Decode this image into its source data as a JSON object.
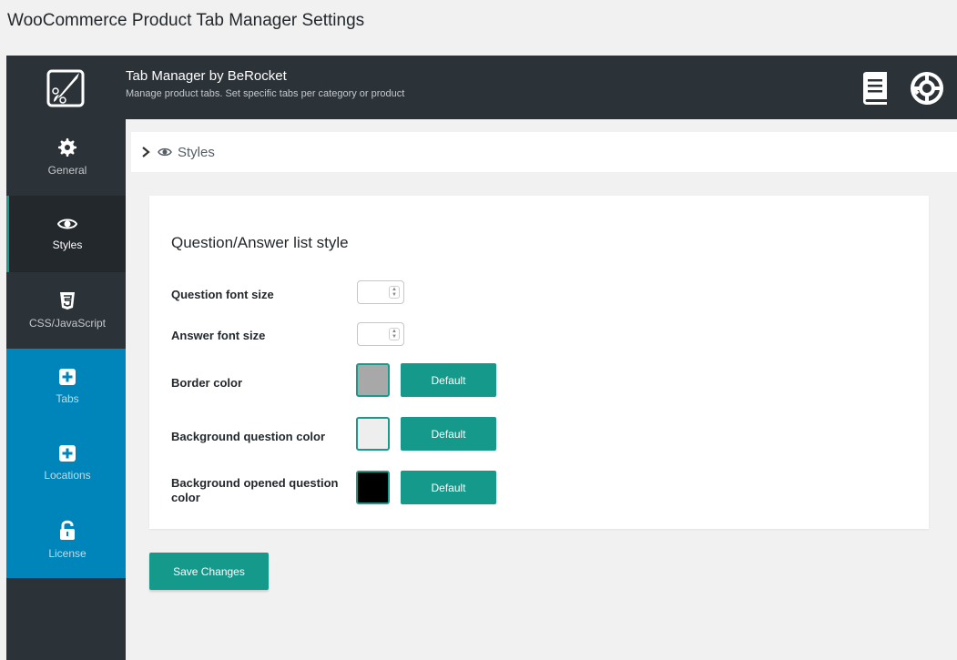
{
  "page": {
    "title": "WooCommerce Product Tab Manager Settings"
  },
  "header": {
    "title": "Tab Manager by BeRocket",
    "subtitle": "Manage product tabs. Set specific tabs per category or product"
  },
  "sidebar": {
    "items": [
      {
        "label": "General",
        "icon": "gear-icon"
      },
      {
        "label": "Styles",
        "icon": "eye-icon"
      },
      {
        "label": "CSS/JavaScript",
        "icon": "css3-icon"
      },
      {
        "label": "Tabs",
        "icon": "plus-square-icon"
      },
      {
        "label": "Locations",
        "icon": "plus-square-icon"
      },
      {
        "label": "License",
        "icon": "unlock-icon"
      }
    ]
  },
  "breadcrumb": {
    "label": "Styles"
  },
  "panel": {
    "heading": "Question/Answer list style",
    "question_font_size": {
      "label": "Question font size",
      "value": ""
    },
    "answer_font_size": {
      "label": "Answer font size",
      "value": ""
    },
    "border_color": {
      "label": "Border color",
      "color": "#a8a8a8",
      "button": "Default"
    },
    "bg_question_color": {
      "label": "Background question color",
      "color": "#eeeeee",
      "button": "Default"
    },
    "bg_opened_question_color": {
      "label": "Background opened question color",
      "color": "#000000",
      "button": "Default"
    }
  },
  "actions": {
    "save_label": "Save Changes"
  },
  "colors": {
    "accent": "#14998a",
    "sidebar_dark": "#2c3338",
    "sidebar_blue": "#0085ba"
  }
}
